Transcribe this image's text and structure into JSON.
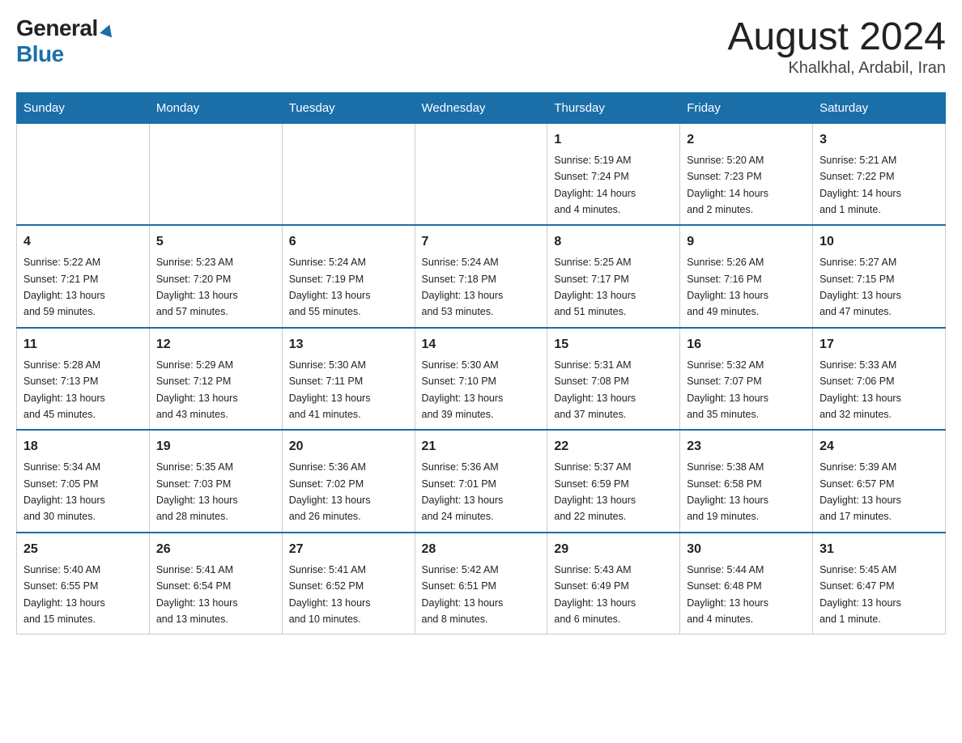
{
  "header": {
    "logo_general": "General",
    "logo_blue": "Blue",
    "title": "August 2024",
    "subtitle": "Khalkhal, Ardabil, Iran"
  },
  "weekdays": [
    "Sunday",
    "Monday",
    "Tuesday",
    "Wednesday",
    "Thursday",
    "Friday",
    "Saturday"
  ],
  "weeks": [
    [
      {
        "day": "",
        "info": ""
      },
      {
        "day": "",
        "info": ""
      },
      {
        "day": "",
        "info": ""
      },
      {
        "day": "",
        "info": ""
      },
      {
        "day": "1",
        "info": "Sunrise: 5:19 AM\nSunset: 7:24 PM\nDaylight: 14 hours\nand 4 minutes."
      },
      {
        "day": "2",
        "info": "Sunrise: 5:20 AM\nSunset: 7:23 PM\nDaylight: 14 hours\nand 2 minutes."
      },
      {
        "day": "3",
        "info": "Sunrise: 5:21 AM\nSunset: 7:22 PM\nDaylight: 14 hours\nand 1 minute."
      }
    ],
    [
      {
        "day": "4",
        "info": "Sunrise: 5:22 AM\nSunset: 7:21 PM\nDaylight: 13 hours\nand 59 minutes."
      },
      {
        "day": "5",
        "info": "Sunrise: 5:23 AM\nSunset: 7:20 PM\nDaylight: 13 hours\nand 57 minutes."
      },
      {
        "day": "6",
        "info": "Sunrise: 5:24 AM\nSunset: 7:19 PM\nDaylight: 13 hours\nand 55 minutes."
      },
      {
        "day": "7",
        "info": "Sunrise: 5:24 AM\nSunset: 7:18 PM\nDaylight: 13 hours\nand 53 minutes."
      },
      {
        "day": "8",
        "info": "Sunrise: 5:25 AM\nSunset: 7:17 PM\nDaylight: 13 hours\nand 51 minutes."
      },
      {
        "day": "9",
        "info": "Sunrise: 5:26 AM\nSunset: 7:16 PM\nDaylight: 13 hours\nand 49 minutes."
      },
      {
        "day": "10",
        "info": "Sunrise: 5:27 AM\nSunset: 7:15 PM\nDaylight: 13 hours\nand 47 minutes."
      }
    ],
    [
      {
        "day": "11",
        "info": "Sunrise: 5:28 AM\nSunset: 7:13 PM\nDaylight: 13 hours\nand 45 minutes."
      },
      {
        "day": "12",
        "info": "Sunrise: 5:29 AM\nSunset: 7:12 PM\nDaylight: 13 hours\nand 43 minutes."
      },
      {
        "day": "13",
        "info": "Sunrise: 5:30 AM\nSunset: 7:11 PM\nDaylight: 13 hours\nand 41 minutes."
      },
      {
        "day": "14",
        "info": "Sunrise: 5:30 AM\nSunset: 7:10 PM\nDaylight: 13 hours\nand 39 minutes."
      },
      {
        "day": "15",
        "info": "Sunrise: 5:31 AM\nSunset: 7:08 PM\nDaylight: 13 hours\nand 37 minutes."
      },
      {
        "day": "16",
        "info": "Sunrise: 5:32 AM\nSunset: 7:07 PM\nDaylight: 13 hours\nand 35 minutes."
      },
      {
        "day": "17",
        "info": "Sunrise: 5:33 AM\nSunset: 7:06 PM\nDaylight: 13 hours\nand 32 minutes."
      }
    ],
    [
      {
        "day": "18",
        "info": "Sunrise: 5:34 AM\nSunset: 7:05 PM\nDaylight: 13 hours\nand 30 minutes."
      },
      {
        "day": "19",
        "info": "Sunrise: 5:35 AM\nSunset: 7:03 PM\nDaylight: 13 hours\nand 28 minutes."
      },
      {
        "day": "20",
        "info": "Sunrise: 5:36 AM\nSunset: 7:02 PM\nDaylight: 13 hours\nand 26 minutes."
      },
      {
        "day": "21",
        "info": "Sunrise: 5:36 AM\nSunset: 7:01 PM\nDaylight: 13 hours\nand 24 minutes."
      },
      {
        "day": "22",
        "info": "Sunrise: 5:37 AM\nSunset: 6:59 PM\nDaylight: 13 hours\nand 22 minutes."
      },
      {
        "day": "23",
        "info": "Sunrise: 5:38 AM\nSunset: 6:58 PM\nDaylight: 13 hours\nand 19 minutes."
      },
      {
        "day": "24",
        "info": "Sunrise: 5:39 AM\nSunset: 6:57 PM\nDaylight: 13 hours\nand 17 minutes."
      }
    ],
    [
      {
        "day": "25",
        "info": "Sunrise: 5:40 AM\nSunset: 6:55 PM\nDaylight: 13 hours\nand 15 minutes."
      },
      {
        "day": "26",
        "info": "Sunrise: 5:41 AM\nSunset: 6:54 PM\nDaylight: 13 hours\nand 13 minutes."
      },
      {
        "day": "27",
        "info": "Sunrise: 5:41 AM\nSunset: 6:52 PM\nDaylight: 13 hours\nand 10 minutes."
      },
      {
        "day": "28",
        "info": "Sunrise: 5:42 AM\nSunset: 6:51 PM\nDaylight: 13 hours\nand 8 minutes."
      },
      {
        "day": "29",
        "info": "Sunrise: 5:43 AM\nSunset: 6:49 PM\nDaylight: 13 hours\nand 6 minutes."
      },
      {
        "day": "30",
        "info": "Sunrise: 5:44 AM\nSunset: 6:48 PM\nDaylight: 13 hours\nand 4 minutes."
      },
      {
        "day": "31",
        "info": "Sunrise: 5:45 AM\nSunset: 6:47 PM\nDaylight: 13 hours\nand 1 minute."
      }
    ]
  ]
}
